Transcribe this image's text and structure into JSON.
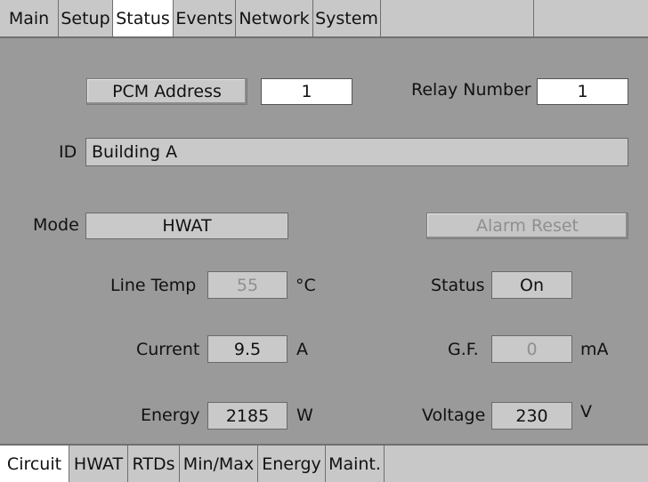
{
  "top_tabs": [
    "Main",
    "Setup",
    "Status",
    "Events",
    "Network",
    "System"
  ],
  "top_active": "Status",
  "bottom_tabs": [
    "Circuit",
    "HWAT",
    "RTDs",
    "Min/Max",
    "Energy",
    "Maint."
  ],
  "bottom_active": "Circuit",
  "pcm": {
    "button_label": "PCM Address",
    "value": "1"
  },
  "relay": {
    "label": "Relay Number",
    "value": "1"
  },
  "id": {
    "label": "ID",
    "value": "Building A"
  },
  "mode": {
    "label": "Mode",
    "value": "HWAT"
  },
  "alarm_reset": {
    "label": "Alarm Reset"
  },
  "line_temp": {
    "label": "Line Temp",
    "value": "55",
    "unit": "°C"
  },
  "status": {
    "label": "Status",
    "value": "On"
  },
  "current": {
    "label": "Current",
    "value": "9.5",
    "unit": "A"
  },
  "gf": {
    "label": "G.F.",
    "value": "0",
    "unit": "mA"
  },
  "energy": {
    "label": "Energy",
    "value": "2185",
    "unit": "W"
  },
  "voltage": {
    "label": "Voltage",
    "value": "230",
    "unit": "V"
  }
}
